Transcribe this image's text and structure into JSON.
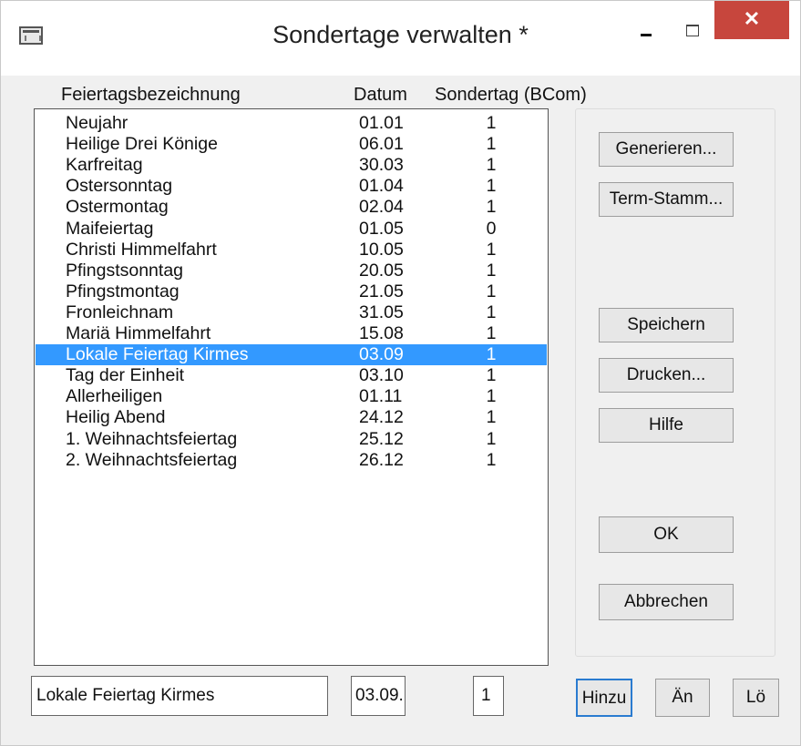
{
  "window": {
    "title": "Sondertage verwalten *",
    "close_glyph": "✕"
  },
  "columns": {
    "name": "Feiertagsbezeichnung",
    "date": "Datum",
    "special": "Sondertag (BCom)"
  },
  "holidays": [
    {
      "name": "Neujahr",
      "date": "01.01",
      "special": "1"
    },
    {
      "name": "Heilige Drei Könige",
      "date": "06.01",
      "special": "1"
    },
    {
      "name": "Karfreitag",
      "date": "30.03",
      "special": "1"
    },
    {
      "name": "Ostersonntag",
      "date": "01.04",
      "special": "1"
    },
    {
      "name": "Ostermontag",
      "date": "02.04",
      "special": "1"
    },
    {
      "name": "Maifeiertag",
      "date": "01.05",
      "special": "0"
    },
    {
      "name": "Christi Himmelfahrt",
      "date": "10.05",
      "special": "1"
    },
    {
      "name": "Pfingstsonntag",
      "date": "20.05",
      "special": "1"
    },
    {
      "name": "Pfingstmontag",
      "date": "21.05",
      "special": "1"
    },
    {
      "name": "Fronleichnam",
      "date": "31.05",
      "special": "1"
    },
    {
      "name": "Mariä Himmelfahrt",
      "date": "15.08",
      "special": "1"
    },
    {
      "name": "Lokale Feiertag Kirmes",
      "date": "03.09",
      "special": "1"
    },
    {
      "name": "Tag der Einheit",
      "date": "03.10",
      "special": "1"
    },
    {
      "name": "Allerheiligen",
      "date": "01.11",
      "special": "1"
    },
    {
      "name": "Heilig Abend",
      "date": "24.12",
      "special": "1"
    },
    {
      "name": "1. Weihnachtsfeiertag",
      "date": "25.12",
      "special": "1"
    },
    {
      "name": "2. Weihnachtsfeiertag",
      "date": "26.12",
      "special": "1"
    }
  ],
  "selected_index": 11,
  "buttons": {
    "generate": "Generieren...",
    "term_master": "Term-Stamm...",
    "save": "Speichern",
    "print": "Drucken...",
    "help": "Hilfe",
    "ok": "OK",
    "cancel": "Abbrechen",
    "add": "Hinzu",
    "change": "Än",
    "delete": "Lö"
  },
  "edit": {
    "name": "Lokale Feiertag Kirmes",
    "date": "03.09.",
    "special": "1"
  },
  "colors": {
    "selection": "#3399ff",
    "close_button": "#c7463d"
  }
}
